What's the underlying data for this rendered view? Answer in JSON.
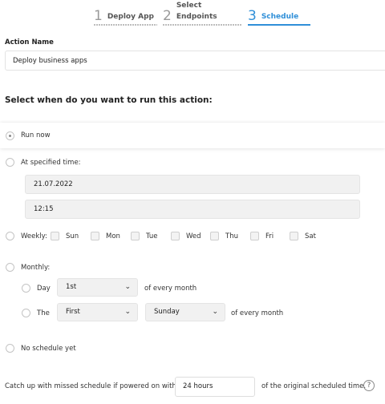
{
  "wizard": {
    "steps": [
      {
        "number": "1",
        "label": "Deploy App",
        "active": false
      },
      {
        "number": "2",
        "label": "Select Endpoints",
        "active": false
      },
      {
        "number": "3",
        "label": "Schedule",
        "active": true
      }
    ]
  },
  "action": {
    "label": "Action Name",
    "value": "Deploy business apps"
  },
  "schedule": {
    "title": "Select when do you want to run this action:",
    "selected": "run_now",
    "run_now": {
      "label": "Run now"
    },
    "specified": {
      "label": "At specified time:",
      "date": "21.07.2022",
      "time": "12:15"
    },
    "weekly": {
      "label": "Weekly:",
      "days": [
        "Sun",
        "Mon",
        "Tue",
        "Wed",
        "Thu",
        "Fri",
        "Sat"
      ]
    },
    "monthly": {
      "label": "Monthly:",
      "day_option": {
        "label": "Day",
        "value": "1st",
        "suffix": "of every month"
      },
      "the_option": {
        "label": "The",
        "ordinal": "First",
        "weekday": "Sunday",
        "suffix": "of every month"
      }
    },
    "none": {
      "label": "No schedule yet"
    }
  },
  "catchup": {
    "label": "Catch up with missed schedule if powered on within",
    "value": "24 hours",
    "suffix": "of the original scheduled time.",
    "help": "?"
  },
  "icons": {
    "chevron": "chevron-down-icon",
    "help": "question-circle-icon"
  },
  "colors": {
    "accent": "#2f8fd8",
    "muted": "#9a9a9a"
  }
}
